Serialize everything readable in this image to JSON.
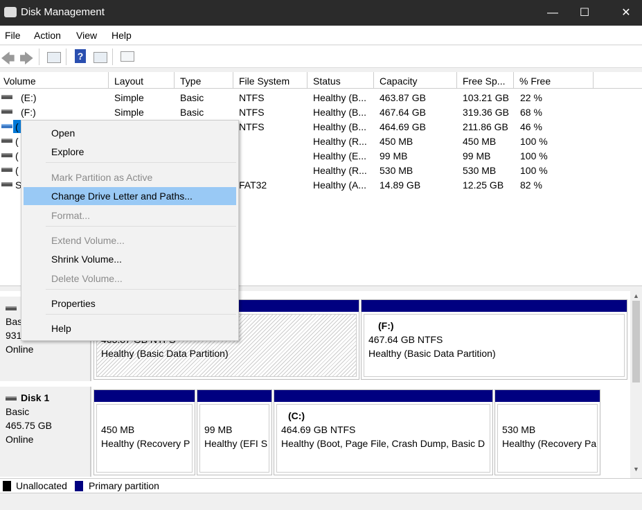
{
  "window": {
    "title": "Disk Management",
    "controls": [
      "minimize",
      "maximize",
      "close"
    ]
  },
  "menubar": [
    "File",
    "Action",
    "View",
    "Help"
  ],
  "toolbar": [
    "back-icon",
    "forward-icon",
    "show-hide-console-tree-icon",
    "help-icon",
    "show-hide-action-pane-icon",
    "properties-icon"
  ],
  "columns": [
    "Volume",
    "Layout",
    "Type",
    "File System",
    "Status",
    "Capacity",
    "Free Sp...",
    "% Free"
  ],
  "rows": [
    {
      "volume": "(E:)",
      "layout": "Simple",
      "type": "Basic",
      "fs": "NTFS",
      "status": "Healthy (B...",
      "capacity": "463.87 GB",
      "free": "103.21 GB",
      "pct": "22 %"
    },
    {
      "volume": "(F:)",
      "layout": "Simple",
      "type": "Basic",
      "fs": "NTFS",
      "status": "Healthy (B...",
      "capacity": "467.64 GB",
      "free": "319.36 GB",
      "pct": "68 %"
    },
    {
      "volume": "(",
      "layout": "",
      "type": "",
      "fs": "NTFS",
      "status": "Healthy (B...",
      "capacity": "464.69 GB",
      "free": "211.86 GB",
      "pct": "46 %"
    },
    {
      "volume": "(",
      "layout": "",
      "type": "",
      "fs": "",
      "status": "Healthy (R...",
      "capacity": "450 MB",
      "free": "450 MB",
      "pct": "100 %"
    },
    {
      "volume": "(",
      "layout": "",
      "type": "",
      "fs": "",
      "status": "Healthy (E...",
      "capacity": "99 MB",
      "free": "99 MB",
      "pct": "100 %"
    },
    {
      "volume": "(",
      "layout": "",
      "type": "",
      "fs": "",
      "status": "Healthy (R...",
      "capacity": "530 MB",
      "free": "530 MB",
      "pct": "100 %"
    },
    {
      "volume": "S",
      "layout": "",
      "type": "",
      "fs": "FAT32",
      "status": "Healthy (A...",
      "capacity": "14.89 GB",
      "free": "12.25 GB",
      "pct": "82 %"
    }
  ],
  "context_menu": [
    {
      "label": "Open",
      "enabled": true
    },
    {
      "label": "Explore",
      "enabled": true
    },
    {
      "label": "Mark Partition as Active",
      "enabled": false
    },
    {
      "label": "Change Drive Letter and Paths...",
      "enabled": true,
      "highlighted": true
    },
    {
      "label": "Format...",
      "enabled": false
    },
    {
      "label": "Extend Volume...",
      "enabled": false
    },
    {
      "label": "Shrink Volume...",
      "enabled": true
    },
    {
      "label": "Delete Volume...",
      "enabled": false
    },
    {
      "label": "Properties",
      "enabled": true
    },
    {
      "label": "Help",
      "enabled": true
    }
  ],
  "disk0": {
    "type": "Bas",
    "size": "931",
    "state": "Online",
    "partitions": [
      {
        "name": "",
        "size": "463.87 GB NTFS",
        "status": "Healthy (Basic Data Partition)"
      },
      {
        "name": "(F:)",
        "size": "467.64 GB NTFS",
        "status": "Healthy (Basic Data Partition)"
      }
    ]
  },
  "disk1": {
    "name": "Disk 1",
    "type": "Basic",
    "size": "465.75 GB",
    "state": "Online",
    "partitions": [
      {
        "name": "",
        "size": "450 MB",
        "status": "Healthy (Recovery P"
      },
      {
        "name": "",
        "size": "99 MB",
        "status": "Healthy (EFI S"
      },
      {
        "name": "(C:)",
        "size": "464.69 GB NTFS",
        "status": "Healthy (Boot, Page File, Crash Dump, Basic D"
      },
      {
        "name": "",
        "size": "530 MB",
        "status": "Healthy (Recovery Pa"
      }
    ]
  },
  "legend": [
    {
      "label": "Unallocated",
      "color": "#000000"
    },
    {
      "label": "Primary partition",
      "color": "#000080"
    }
  ],
  "colors": {
    "primary": "#000080",
    "highlight": "#99c9f5",
    "selection": "#0078d7"
  }
}
